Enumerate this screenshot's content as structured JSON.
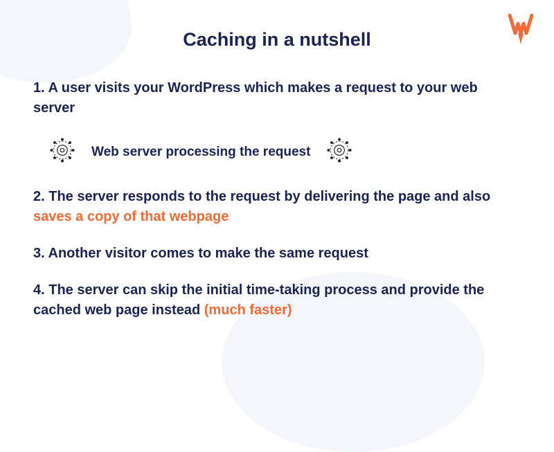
{
  "title": "Caching in a nutshell",
  "logo": "wp-rocket-logo",
  "steps": {
    "s1": "1. A user visits your WordPress which makes a request to your web server",
    "processing": "Web server processing the request",
    "s2_prefix": "2. The server responds to the request by delivering the page and also ",
    "s2_highlight": "saves a copy of that webpage",
    "s3": "3. Another visitor comes to make the same request",
    "s4_prefix": "4. The server can skip the initial time-taking process and provide the cached web page instead ",
    "s4_highlight": "(much faster)"
  },
  "colors": {
    "navy": "#1a2352",
    "orange": "#f26a35",
    "blob": "#f4f6fb"
  }
}
